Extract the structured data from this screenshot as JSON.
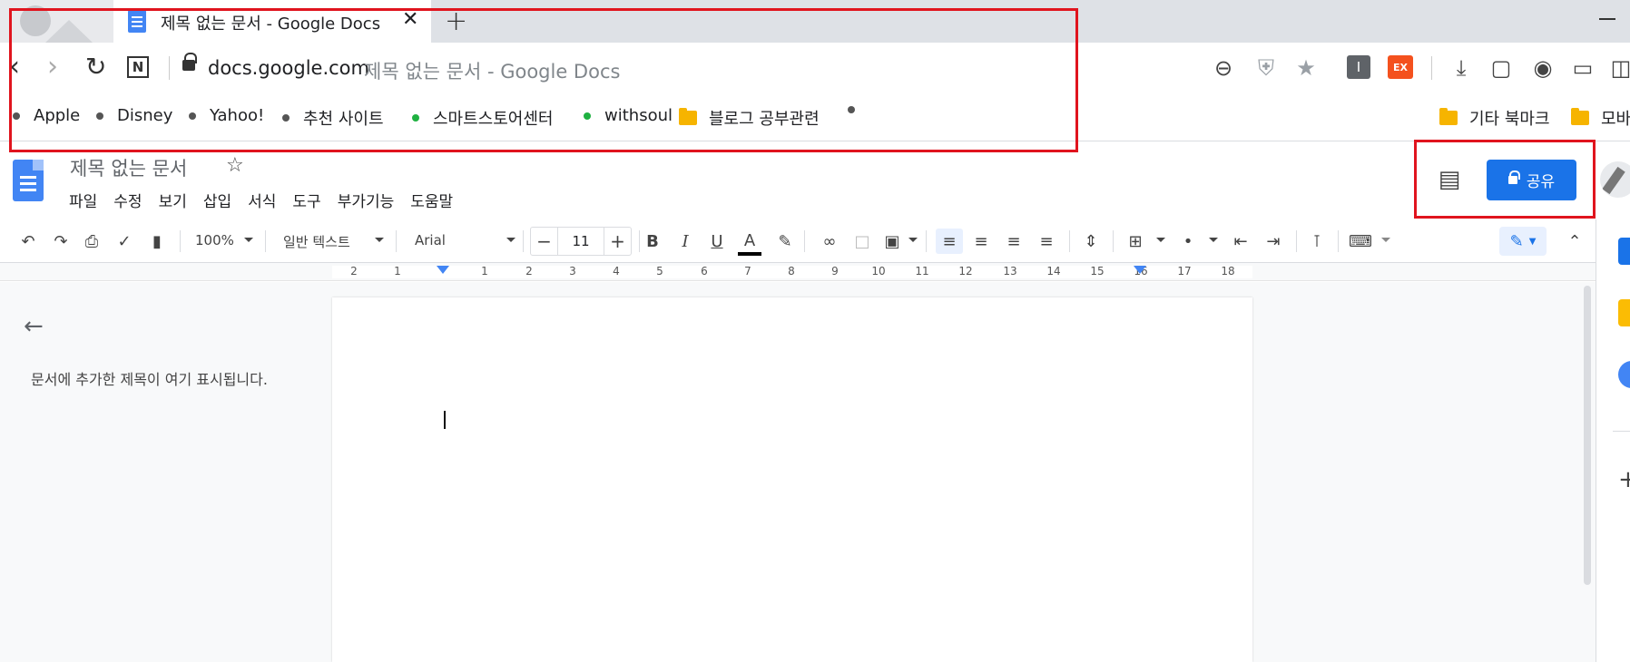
{
  "browser": {
    "tab_title": "제목 없는 문서 - Google Docs",
    "tab_close": "✕",
    "new_tab": "+",
    "url_host": "docs.google.com",
    "url_rest": "제목 없는 문서 - Google Docs",
    "icons": [
      "back-icon",
      "forward-icon",
      "reload-icon",
      "n-icon",
      "lock-icon",
      "zoom-out-icon",
      "shield-icon",
      "star-icon",
      "extension-i-icon",
      "extension-ex-icon",
      "download-icon",
      "video-icon",
      "camera-icon",
      "info-icon",
      "sidebar-icon"
    ],
    "ext_ex_label": "EX",
    "ext_i_label": "I",
    "n_label": "N"
  },
  "bookmarks": [
    {
      "label": "Apple",
      "kind": "dot"
    },
    {
      "label": "Disney",
      "kind": "dot"
    },
    {
      "label": "Yahoo!",
      "kind": "dot"
    },
    {
      "label": "추천 사이트",
      "kind": "dot"
    },
    {
      "label": "스마트스토어센터",
      "kind": "green"
    },
    {
      "label": "withsoul",
      "kind": "green"
    },
    {
      "label": "블로그 공부관련",
      "kind": "folder"
    }
  ],
  "bookmarks_right": [
    {
      "label": "기타 북마크"
    },
    {
      "label": "모바"
    }
  ],
  "docs": {
    "title": "제목 없는 문서",
    "menu": [
      "파일",
      "수정",
      "보기",
      "삽입",
      "서식",
      "도구",
      "부가기능",
      "도움말"
    ],
    "share_label": "공유",
    "outline_hint": "문서에 추가한 제목이 여기 표시됩니다."
  },
  "toolbar": {
    "zoom": "100%",
    "style": "일반 텍스트",
    "font": "Arial",
    "font_size": "11",
    "bold": "B",
    "italic": "I",
    "underline": "U",
    "text_color": "A"
  },
  "ruler": {
    "numbers": [
      "2",
      "1",
      "1",
      "2",
      "3",
      "4",
      "5",
      "6",
      "7",
      "8",
      "9",
      "10",
      "11",
      "12",
      "13",
      "14",
      "15",
      "16",
      "17",
      "18"
    ]
  },
  "colors": {
    "accent": "#1a73e8",
    "highlight_box": "#e0141e",
    "folder": "#f6b400",
    "green_dot": "#1fb141"
  }
}
